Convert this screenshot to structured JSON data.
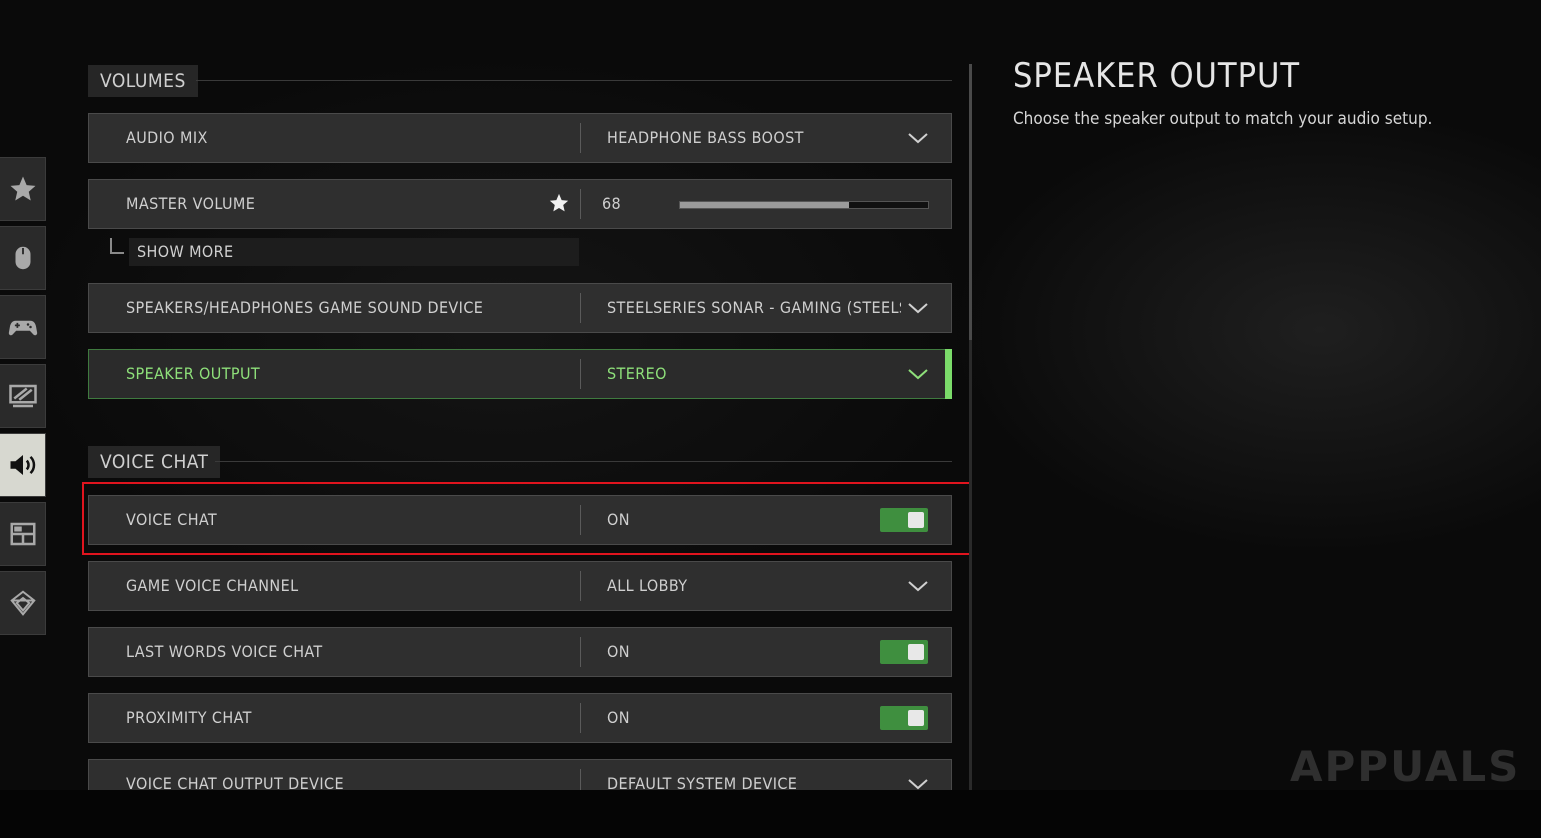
{
  "sections": {
    "volumes": "VOLUMES",
    "voice_chat": "VOICE CHAT"
  },
  "rows": {
    "audio_mix": {
      "label": "AUDIO MIX",
      "value": "HEADPHONE BASS BOOST"
    },
    "master_volume": {
      "label": "MASTER VOLUME",
      "value": "68",
      "level": 68
    },
    "show_more": "SHOW MORE",
    "sound_device": {
      "label": "SPEAKERS/HEADPHONES GAME SOUND DEVICE",
      "value": "STEELSERIES SONAR - GAMING (STEELSERIES SONAR VIRTUAL AUDIO DEVICE)"
    },
    "speaker_output": {
      "label": "SPEAKER OUTPUT",
      "value": "STEREO"
    },
    "voice_chat": {
      "label": "VOICE CHAT",
      "value": "ON",
      "toggle": true
    },
    "game_voice_channel": {
      "label": "GAME VOICE CHANNEL",
      "value": "ALL LOBBY"
    },
    "last_words": {
      "label": "LAST WORDS VOICE CHAT",
      "value": "ON",
      "toggle": true
    },
    "proximity_chat": {
      "label": "PROXIMITY CHAT",
      "value": "ON",
      "toggle": true
    },
    "voice_output_device": {
      "label": "VOICE CHAT OUTPUT DEVICE",
      "value": "DEFAULT SYSTEM DEVICE"
    }
  },
  "sidebar": {
    "icons": [
      "star-icon",
      "mouse-icon",
      "controller-icon",
      "display-icon",
      "speaker-icon",
      "interface-icon",
      "network-icon"
    ],
    "active": "speaker-icon"
  },
  "description": {
    "title": "SPEAKER OUTPUT",
    "text": "Choose the speaker output to match your audio setup."
  },
  "watermark": "APPUALS",
  "colors": {
    "accent_green": "#7bdc6a",
    "toggle_on": "#3f8f3f",
    "highlight_red": "#e0141e"
  }
}
